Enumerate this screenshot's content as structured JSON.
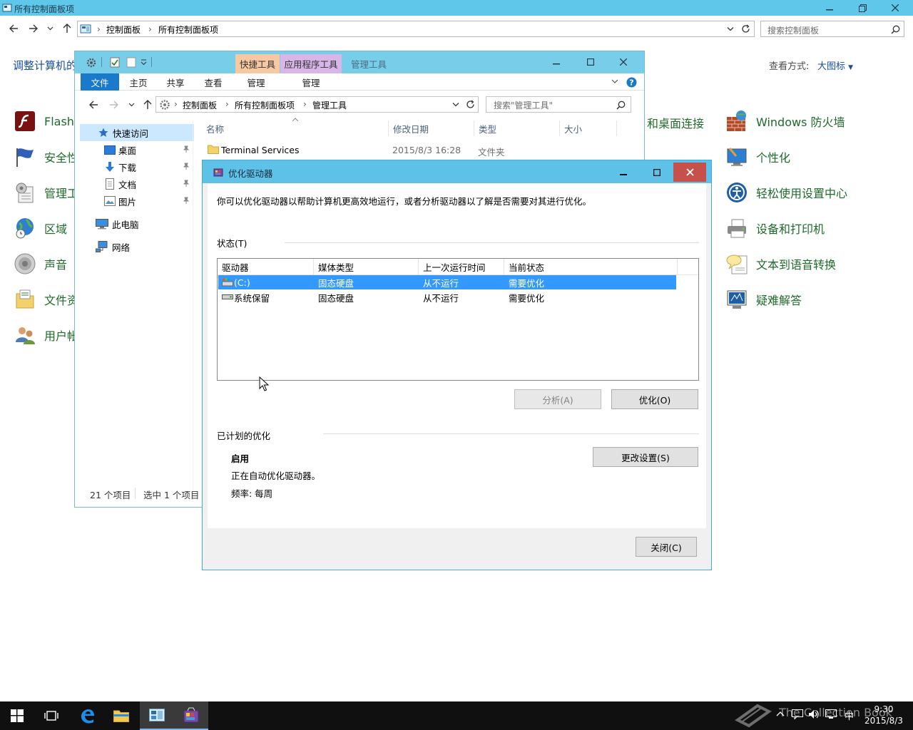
{
  "control_panel": {
    "title": "所有控制面板项",
    "address": {
      "root_crumb": "控制面板",
      "current_crumb": "所有控制面板项"
    },
    "search_placeholder": "搜索控制面板",
    "heading": "调整计算机的",
    "view_label": "查看方式:",
    "view_value": "大图标",
    "left_items": [
      "Flash",
      "安全性",
      "管理工",
      "区域",
      "声音",
      "文件资",
      "用户帐"
    ],
    "middle_item": "和桌面连接",
    "right_items": [
      "Windows 防火墙",
      "个性化",
      "轻松使用设置中心",
      "设备和打印机",
      "文本到语音转换",
      "疑难解答"
    ]
  },
  "explorer": {
    "context_tab_shortcut": "快捷工具",
    "context_tab_app": "应用程序工具",
    "title": "管理工具",
    "ribbon_tabs": [
      "文件",
      "主页",
      "共享",
      "查看",
      "管理",
      "管理"
    ],
    "address": {
      "crumb1": "控制面板",
      "crumb2": "所有控制面板项",
      "crumb3": "管理工具"
    },
    "search_placeholder": "搜索\"管理工具\"",
    "nav_tree": {
      "quick_access": "快速访问",
      "desktop": "桌面",
      "downloads": "下载",
      "documents": "文档",
      "pictures": "图片",
      "this_pc": "此电脑",
      "network": "网络"
    },
    "columns": {
      "name": "名称",
      "modified": "修改日期",
      "type": "类型",
      "size": "大小"
    },
    "file": {
      "name": "Terminal Services",
      "modified": "2015/8/3 16:28",
      "type": "文件夹"
    },
    "status_count": "21 个项目",
    "status_selected": "选中 1 个项目"
  },
  "dialog": {
    "title": "优化驱动器",
    "description": "你可以优化驱动器以帮助计算机更高效地运行，或者分析驱动器以了解是否需要对其进行优化。",
    "status_label": "状态(T)",
    "columns": {
      "drive": "驱动器",
      "media": "媒体类型",
      "last_run": "上一次运行时间",
      "status": "当前状态"
    },
    "drives": [
      {
        "name": "(C:)",
        "media": "固态硬盘",
        "last_run": "从不运行",
        "status": "需要优化"
      },
      {
        "name": "系统保留",
        "media": "固态硬盘",
        "last_run": "从不运行",
        "status": "需要优化"
      }
    ],
    "analyze_button": "分析(A)",
    "optimize_button": "优化(O)",
    "scheduled_label": "已计划的优化",
    "schedule_state": "启用",
    "schedule_desc": "正在自动优化驱动器。",
    "frequency": "频率: 每周",
    "change_settings_button": "更改设置(S)",
    "close_button": "关闭(C)"
  },
  "taskbar": {
    "clock_time": "9:30",
    "clock_date": "2015/8/3",
    "ime": "中",
    "watermark": "The Collection Book"
  },
  "colors": {
    "accent_title": "#5fc7ea",
    "selection": "#3399ff",
    "link_blue": "#1a4fa0",
    "item_green": "#1e6a2b",
    "file_tab": "#1979ca"
  }
}
